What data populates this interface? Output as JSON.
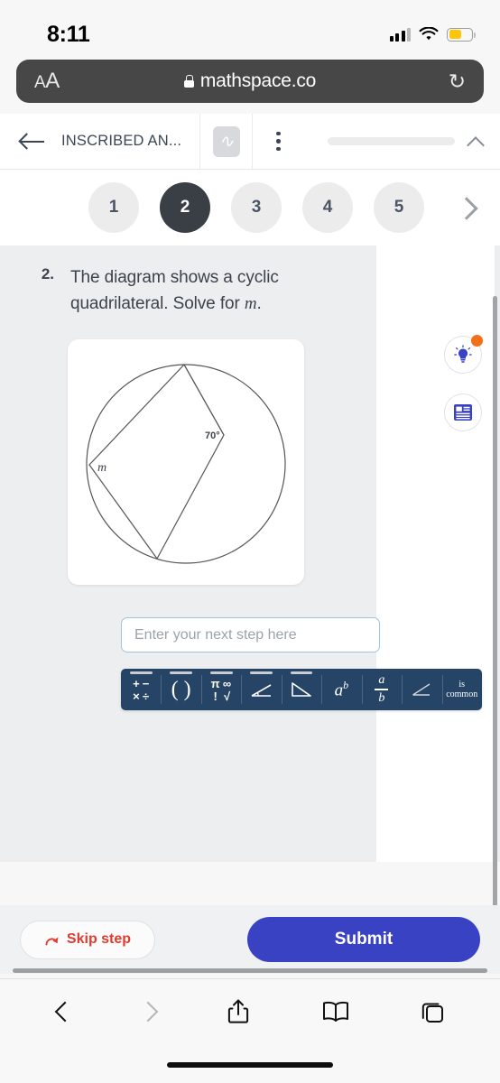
{
  "status_bar": {
    "time": "8:11",
    "signal_icon": "cellular-bars-icon",
    "wifi_icon": "wifi-icon",
    "battery_icon": "battery-low-power-icon",
    "battery_color": "#fdc60b"
  },
  "browser": {
    "text_size_label": "AA",
    "lock_icon": "lock-icon",
    "url": "mathspace.co",
    "reload_icon": "reload-icon",
    "bottom_toolbar": {
      "back_icon": "chevron-left-icon",
      "forward_icon": "chevron-right-icon",
      "share_icon": "share-icon",
      "bookmarks_icon": "book-icon",
      "tabs_icon": "tabs-icon"
    }
  },
  "app_header": {
    "back_icon": "arrow-left-icon",
    "title": "INSCRIBED AN...",
    "scribble_icon": "scribble-pad-icon",
    "overflow_icon": "more-vertical-icon",
    "progress_percent": 0,
    "collapse_icon": "chevron-up-icon"
  },
  "pager": {
    "steps": [
      {
        "label": "1",
        "active": false
      },
      {
        "label": "2",
        "active": true
      },
      {
        "label": "3",
        "active": false
      },
      {
        "label": "4",
        "active": false
      },
      {
        "label": "5",
        "active": false
      }
    ],
    "next_icon": "chevron-right-icon"
  },
  "question": {
    "number": "2.",
    "text_part1": "The diagram shows a cyclic quadrilateral. Solve for ",
    "variable": "m",
    "text_part2": "."
  },
  "diagram": {
    "type": "cyclic-quadrilateral-in-circle",
    "angle_label": "70°",
    "variable_label": "m",
    "stroke_color": "#565656"
  },
  "side_tools": [
    {
      "name": "hint-lightbulb-button",
      "icon": "lightbulb-icon",
      "badge": true,
      "badge_color": "#f3701b",
      "color": "#3a42c4"
    },
    {
      "name": "reference-button",
      "icon": "book-reference-icon",
      "badge": false,
      "color": "#3a42c4"
    }
  ],
  "answer": {
    "placeholder": "Enter your next step here",
    "value": ""
  },
  "math_toolbar": {
    "background": "#254466",
    "buttons": [
      {
        "name": "operators-button",
        "glyphs": [
          "+",
          "−",
          "×",
          "÷"
        ],
        "tabbed": true
      },
      {
        "name": "parentheses-button",
        "label": "( )",
        "tabbed": true
      },
      {
        "name": "constants-button",
        "glyphs": [
          "π",
          "∞",
          "!",
          "√"
        ],
        "tabbed": true
      },
      {
        "name": "angle-button",
        "icon": "angle-icon",
        "tabbed": true
      },
      {
        "name": "triangle-button",
        "icon": "right-triangle-icon",
        "tabbed": true
      },
      {
        "name": "power-button",
        "label_base": "a",
        "label_exp": "b",
        "tabbed": false
      },
      {
        "name": "fraction-button",
        "numerator": "a",
        "denominator": "b",
        "tabbed": false
      },
      {
        "name": "angle-symbol-button",
        "icon": "angle-icon",
        "tabbed": false
      },
      {
        "name": "is-common-button",
        "line1": "is",
        "line2": "common",
        "tabbed": false
      }
    ]
  },
  "footer": {
    "skip_label": "Skip step",
    "skip_icon": "skip-arrow-icon",
    "skip_color": "#e03b2f",
    "submit_label": "Submit",
    "submit_color": "#3a42c4"
  }
}
